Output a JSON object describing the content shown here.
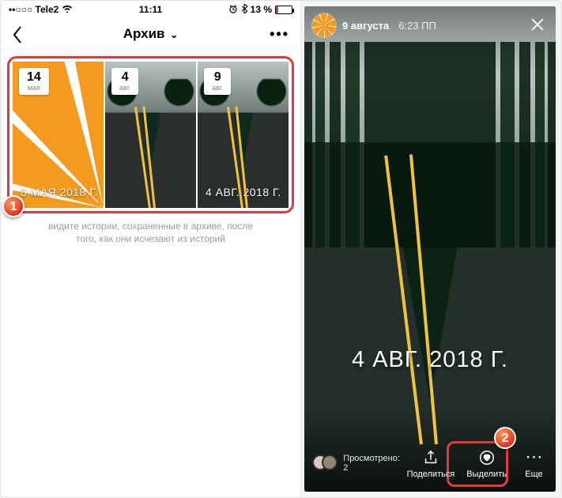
{
  "left": {
    "status": {
      "carrier_dots": "••○○○",
      "carrier": "Tele2",
      "wifi_icon": "wifi",
      "time": "11:11",
      "alarm_icon": "alarm",
      "bt_icon": "bluetooth",
      "battery_text": "13 %"
    },
    "header": {
      "title": "Архив",
      "more": "•••"
    },
    "tiles": [
      {
        "day": "14",
        "month": "мая",
        "stamp": "8 МАЯ 2018 Г.",
        "kind": "orange"
      },
      {
        "day": "4",
        "month": "авг.",
        "stamp": "",
        "kind": "road"
      },
      {
        "day": "9",
        "month": "авг.",
        "stamp": "4 АВГ. 2018 Г.",
        "kind": "road"
      }
    ],
    "info_line1": "видите истории, сохраненные в архиве, после",
    "info_line2": "того, как они исчезают из историй"
  },
  "right": {
    "date": "9 августа",
    "time": "6:23 ПП",
    "big_stamp": "4 АВГ. 2018 Г.",
    "seen_label": "Просмотрено: 2",
    "share_label": "Поделиться",
    "highlight_label": "Выделить",
    "more_label": "Еще"
  },
  "callouts": {
    "one": "1",
    "two": "2"
  }
}
